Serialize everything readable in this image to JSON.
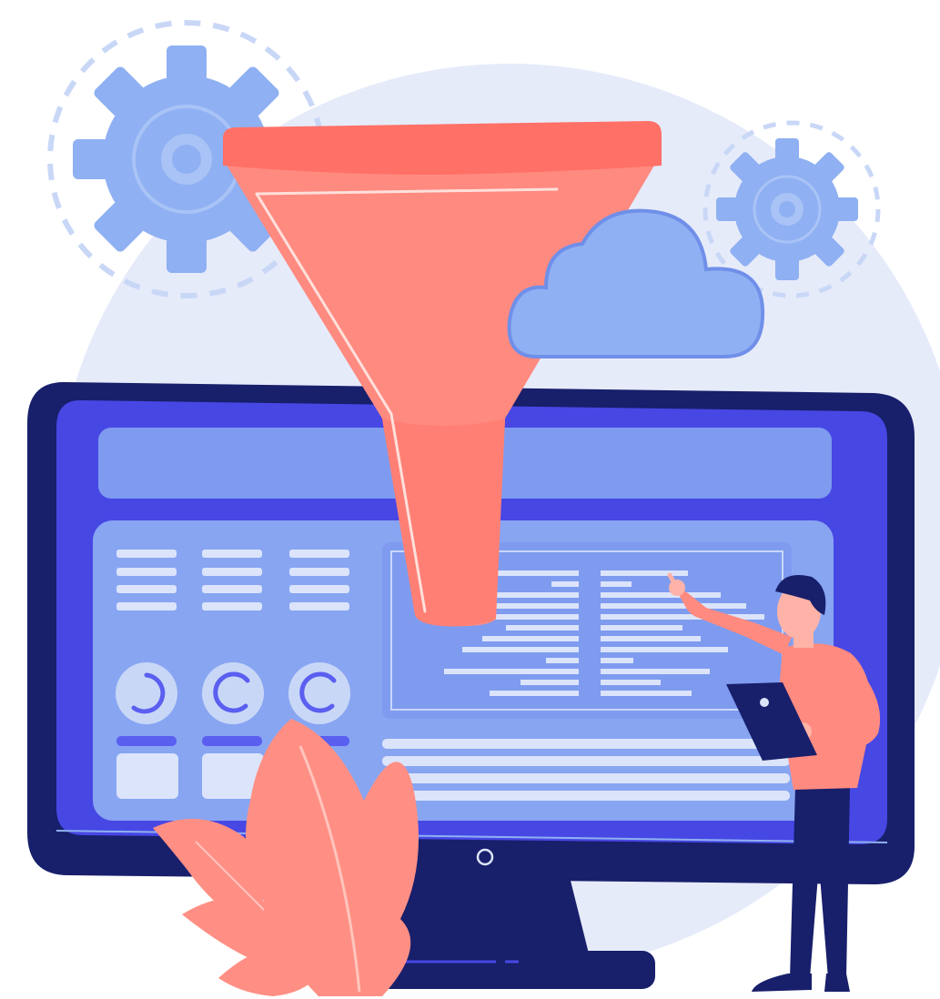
{
  "scene": {
    "subject": "",
    "colors": {
      "background": "#ffffff",
      "backdrop_circle": "#e6ebfa",
      "gear": "#8fb0f2",
      "gear_inner": "#a9c3f6",
      "dashed_ring": "#c9d7f7",
      "funnel_top": "#ff7066",
      "funnel_body": "#ff8a80",
      "funnel_highlight": "#ffe0db",
      "cloud": "#8fb0f2",
      "cloud_outline": "#6f8fe9",
      "monitor_frame": "#181f6b",
      "monitor_screen": "#4747e4",
      "screen_panel": "#88a5f2",
      "screen_lines": "#dbe4fb",
      "accent_blue": "#5a5ff0",
      "leaf": "#ff8f84",
      "leaf_vein": "#ffc5bd",
      "person_shirt": "#ff8a80",
      "person_pants": "#181f6b",
      "person_skin": "#ffb3a8",
      "person_hair": "#181f6b"
    },
    "icons": [
      "gear-icon",
      "funnel-icon",
      "cloud-icon",
      "monitor-icon",
      "leaf-icon",
      "person-figure",
      "tablet-icon"
    ]
  }
}
